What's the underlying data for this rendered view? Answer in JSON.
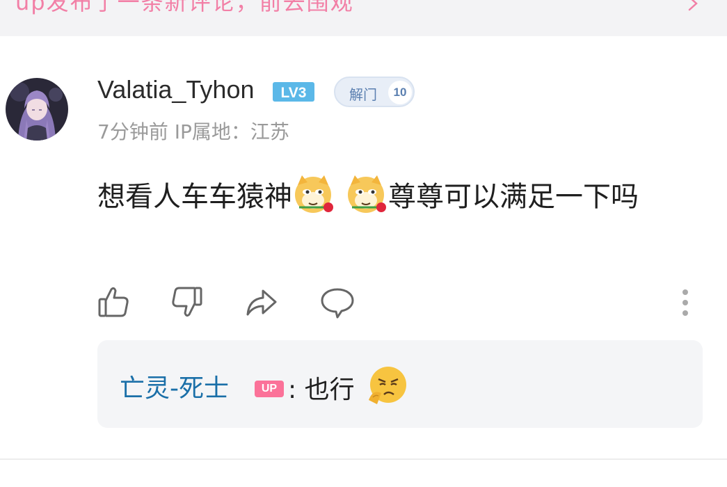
{
  "banner": {
    "text": "up发布了一条新评论，前去围观",
    "icon": "chevron-right-icon"
  },
  "comment": {
    "avatar_icon": "anime-girl-avatar",
    "username": "Valatia_Tyhon",
    "level_icon": "lv3-badge",
    "level_color": "#5bb8e8",
    "fan_badge": {
      "label": "解门",
      "level": "10"
    },
    "meta": "7分钟前 IP属地：江苏",
    "text_part1": "想看人车车猿神",
    "emoji_1": "doge-rose-emoji",
    "emoji_2": "doge-rose-emoji",
    "text_part2": "尊尊可以满足一下吗"
  },
  "actions": [
    {
      "name": "like",
      "icon": "thumbs-up-icon"
    },
    {
      "name": "dislike",
      "icon": "thumbs-down-icon"
    },
    {
      "name": "share",
      "icon": "share-arrow-icon"
    },
    {
      "name": "reply",
      "icon": "comment-bubble-icon"
    }
  ],
  "more_icon": "more-vertical-icon",
  "reply": {
    "username": "亡灵-死士",
    "badge": "UP",
    "badge_color": "#fb7299",
    "separator": ":",
    "text": "也行",
    "emoji": "frustrated-face-emoji"
  }
}
